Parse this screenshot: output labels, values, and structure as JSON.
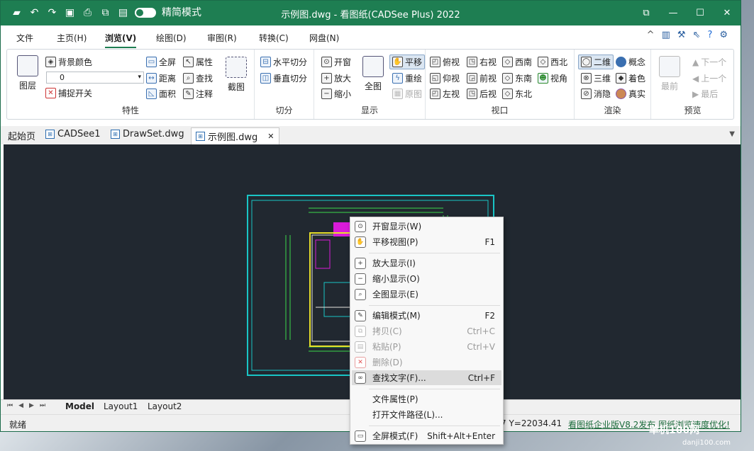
{
  "titlebar": {
    "title": "示例图.dwg - 看图纸(CADSee Plus) 2022",
    "mode_label": "精简模式",
    "win_buttons": [
      "⧉",
      "—",
      "☐",
      "✕"
    ]
  },
  "menu": {
    "items": [
      "文件",
      "主页(H)",
      "浏览(V)",
      "绘图(D)",
      "审图(R)",
      "转换(C)",
      "网盘(N)"
    ],
    "active": "浏览(V)"
  },
  "ribbon": {
    "attr": {
      "label": "特性",
      "layer": "图层",
      "bgcolor": "背景颜色",
      "layer_value": "0",
      "snap": "捕捉开关",
      "fullscreen": "全屏",
      "distance": "距离",
      "area": "面积",
      "property": "属性",
      "find": "查找",
      "annotate": "注释",
      "capture": "截图"
    },
    "split": {
      "label": "切分",
      "h": "水平切分",
      "v": "垂直切分"
    },
    "display": {
      "label": "显示",
      "window": "开窗",
      "zoomin": "放大",
      "zoomout": "缩小",
      "all": "全图",
      "pan": "平移",
      "redraw": "重绘",
      "original": "原图"
    },
    "view": {
      "label": "视口",
      "items": [
        "俯视",
        "右视",
        "西南",
        "西北",
        "仰视",
        "前视",
        "东南",
        "视角",
        "左视",
        "后视",
        "东北"
      ]
    },
    "render": {
      "label": "渲染",
      "items": [
        "二维",
        "概念",
        "三维",
        "着色",
        "消隐",
        "真实"
      ]
    },
    "preview": {
      "label": "预览",
      "latest": "最前",
      "next": "下一个",
      "prev": "上一个",
      "last": "最后"
    }
  },
  "tabs": {
    "items": [
      "起始页",
      "CADSee1",
      "DrawSet.dwg",
      "示例图.dwg"
    ]
  },
  "layouts": {
    "items": [
      "Model",
      "Layout1",
      "Layout2"
    ]
  },
  "status": {
    "left": "就绪",
    "coord": "7 Y=22034.41",
    "news": "看图纸企业版V8.2发布,图纸浏览速度优化!"
  },
  "context_menu": [
    {
      "label": "开窗显示(W)",
      "shortcut": "",
      "icon": "window-zoom-icon",
      "disabled": false
    },
    {
      "label": "平移视图(P)",
      "shortcut": "F1",
      "icon": "pan-icon",
      "disabled": false
    },
    {
      "label": "放大显示(I)",
      "shortcut": "",
      "icon": "zoom-in-icon",
      "disabled": false
    },
    {
      "label": "缩小显示(O)",
      "shortcut": "",
      "icon": "zoom-out-icon",
      "disabled": false
    },
    {
      "label": "全图显示(E)",
      "shortcut": "",
      "icon": "zoom-extents-icon",
      "disabled": false
    },
    {
      "label": "编辑模式(M)",
      "shortcut": "F2",
      "icon": "edit-icon",
      "disabled": false
    },
    {
      "label": "拷贝(C)",
      "shortcut": "Ctrl+C",
      "icon": "copy-icon",
      "disabled": true
    },
    {
      "label": "粘贴(P)",
      "shortcut": "Ctrl+V",
      "icon": "paste-icon",
      "disabled": true
    },
    {
      "label": "删除(D)",
      "shortcut": "",
      "icon": "delete-icon",
      "disabled": true
    },
    {
      "label": "查找文字(F)...",
      "shortcut": "Ctrl+F",
      "icon": "binoculars-icon",
      "disabled": false
    },
    {
      "label": "文件属性(P)",
      "shortcut": "",
      "icon": "",
      "disabled": false
    },
    {
      "label": "打开文件路径(L)...",
      "shortcut": "",
      "icon": "",
      "disabled": false
    },
    {
      "label": "全屏模式(F)",
      "shortcut": "Shift+Alt+Enter",
      "icon": "fullscreen-icon",
      "disabled": false
    }
  ],
  "watermark": {
    "main": "单机100网",
    "sub": "danji100.com"
  }
}
